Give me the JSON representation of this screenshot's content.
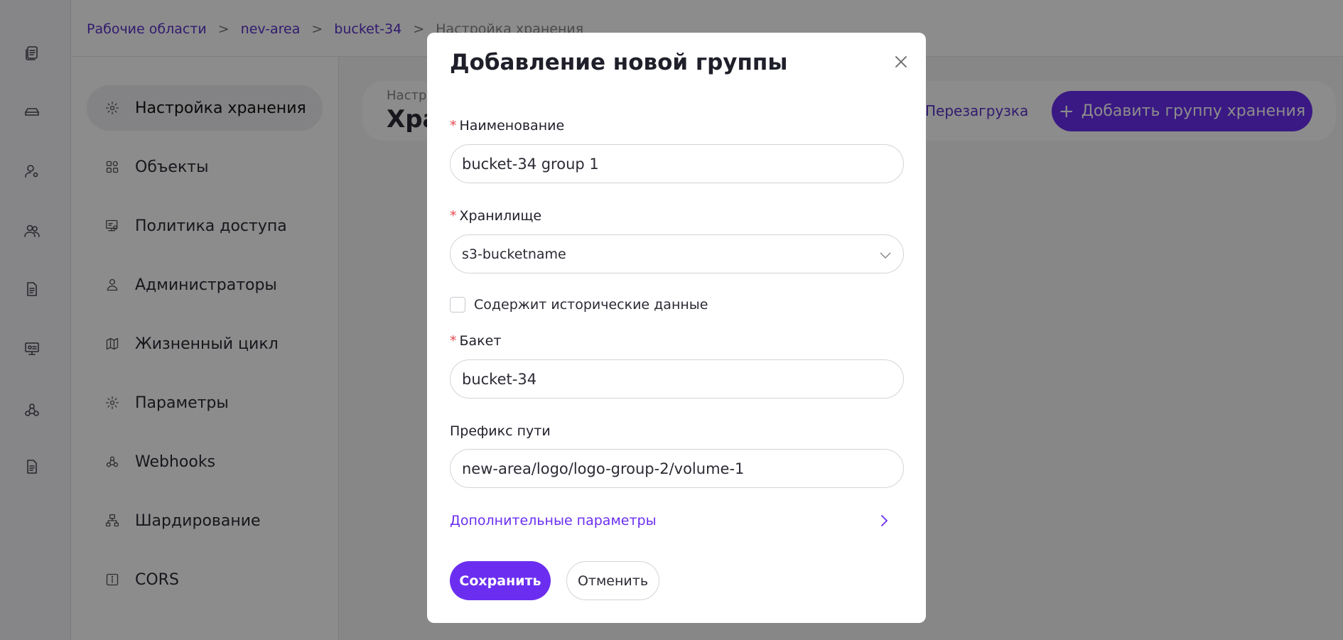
{
  "rail": {
    "icons": [
      "documents-icon",
      "storage-icon",
      "user-settings-icon",
      "users-icon",
      "file-icon",
      "monitor-icon",
      "webhooks-icon",
      "report-icon"
    ]
  },
  "breadcrumb": {
    "items": [
      "Рабочие области",
      "nev-area",
      "bucket-34"
    ],
    "current": "Настройка хранения",
    "separator": ">"
  },
  "sidebar": {
    "items": [
      {
        "label": "Настройка хранения",
        "icon": "gear-icon",
        "active": true
      },
      {
        "label": "Объекты",
        "icon": "objects-icon"
      },
      {
        "label": "Политика доступа",
        "icon": "access-policy-icon"
      },
      {
        "label": "Администраторы",
        "icon": "admin-icon"
      },
      {
        "label": "Жизненный цикл",
        "icon": "map-icon"
      },
      {
        "label": "Параметры",
        "icon": "settings-icon"
      },
      {
        "label": "Webhooks",
        "icon": "webhooks-icon"
      },
      {
        "label": "Шардирование",
        "icon": "sharding-icon"
      },
      {
        "label": "CORS",
        "icon": "info-icon"
      }
    ]
  },
  "header": {
    "subtitle": "Настр",
    "title": "Хра",
    "reload_label": "Перезагрузка",
    "add_group_label": "Добавить группу хранения",
    "add_group_icon": "+"
  },
  "modal": {
    "title": "Добавление новой группы",
    "fields": {
      "name": {
        "label": "Наименование",
        "required": true,
        "value": "bucket-34 group 1"
      },
      "storage": {
        "label": "Хранилище",
        "required": true,
        "value": "s3-bucketname"
      },
      "historical": {
        "label": "Содержит исторические данные",
        "checked": false
      },
      "bucket": {
        "label": "Бакет",
        "required": true,
        "value": "bucket-34"
      },
      "prefix": {
        "label": "Префикс пути",
        "required": false,
        "value": "new-area/logo/logo-group-2/volume-1"
      }
    },
    "advanced_label": "Дополнительные параметры",
    "save_label": "Сохранить",
    "cancel_label": "Отменить",
    "required_mark": "*"
  },
  "colors": {
    "accent": "#6b2ef0",
    "link": "#5a31c8",
    "required": "#e5484d",
    "overlay": "rgba(0,0,0,0.45)"
  }
}
